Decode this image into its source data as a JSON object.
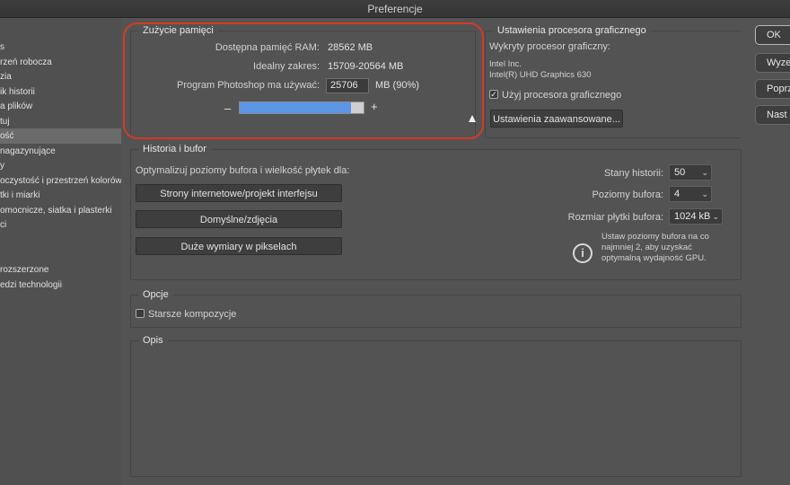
{
  "window": {
    "title": "Preferencje"
  },
  "sidebar": {
    "items": [
      {
        "label": "s"
      },
      {
        "label": "rzeń robocza"
      },
      {
        "label": "zia"
      },
      {
        "label": "ik historii"
      },
      {
        "label": "a plików"
      },
      {
        "label": "tuj"
      },
      {
        "label": "ość",
        "selected": true
      },
      {
        "label": "nagazynujące"
      },
      {
        "label": "y"
      },
      {
        "label": "oczystość i przestrzeń kolorów"
      },
      {
        "label": "tki i miarki"
      },
      {
        "label": "omocnicze, siatka i plasterki"
      },
      {
        "label": "ci"
      },
      {
        "label": ""
      },
      {
        "label": ""
      },
      {
        "label": "rozszerzone"
      },
      {
        "label": "edzi technologii"
      }
    ]
  },
  "memory": {
    "title": "Zużycie pamięci",
    "available_label": "Dostępna pamięć RAM:",
    "available_value": "28562 MB",
    "ideal_label": "Idealny zakres:",
    "ideal_value": "15709-20564 MB",
    "use_label": "Program Photoshop ma używać:",
    "use_value": "25706",
    "use_unit": "MB (90%)",
    "slider_fraction": 0.9,
    "minus": "–",
    "plus": "+"
  },
  "gpu": {
    "title": "Ustawienia procesora graficznego",
    "detected_label": "Wykryty procesor graficzny:",
    "vendor": "Intel Inc.",
    "model": "Intel(R) UHD Graphics 630",
    "use_gpu_label": "Użyj procesora graficznego",
    "use_gpu_checked": "✓",
    "advanced_button": "Ustawienia zaawansowane..."
  },
  "history": {
    "title": "Historia i bufor",
    "optimize_label": "Optymalizuj poziomy bufora i wielkość płytek dla:",
    "buttons": [
      "Strony internetowe/projekt interfejsu",
      "Domyślne/zdjęcia",
      "Duże wymiary w pikselach"
    ],
    "states_label": "Stany historii:",
    "states_value": "50",
    "cache_levels_label": "Poziomy bufora:",
    "cache_levels_value": "4",
    "tile_size_label": "Rozmiar płytki bufora:",
    "tile_size_value": "1024 kB",
    "info_line1": "Ustaw poziomy bufora na co",
    "info_line2": "najmniej 2, aby uzyskać",
    "info_line3": "optymalną wydajność GPU."
  },
  "options": {
    "title": "Opcje",
    "legacy_label": "Starsze kompozycje"
  },
  "description": {
    "title": "Opis"
  },
  "actions": {
    "ok": "OK",
    "reset": "Wyze",
    "prev": "Poprz",
    "next": "Nast"
  }
}
